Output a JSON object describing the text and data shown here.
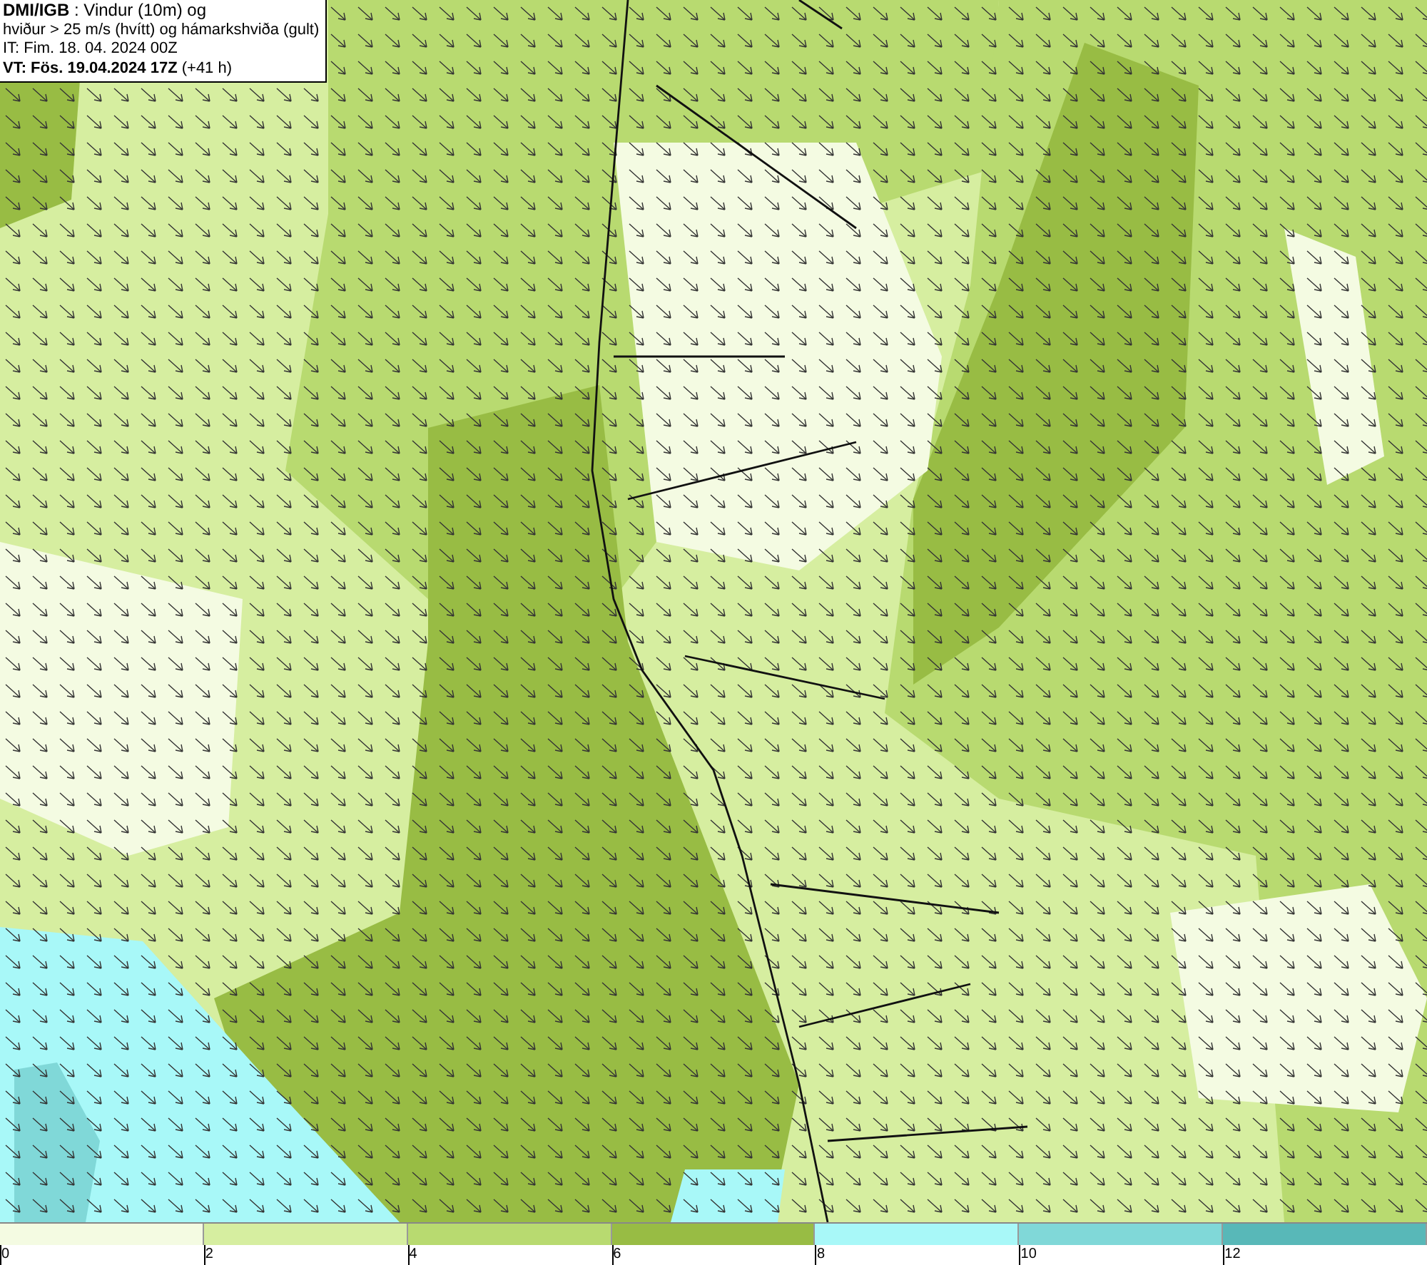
{
  "header": {
    "lines": [
      "**DMI/IGB** : Vindur (10m) og",
      "hviður > 25 m/s (hvítt) og hámarkshviða (gult)",
      "IT: Fim. 18. 04. 2024 00Z",
      "**VT: Fös. 19.04.2024 17Z** (+41 h)"
    ]
  },
  "legend": {
    "segments": [
      {
        "color": "#f4fbe2"
      },
      {
        "color": "#d6eea0"
      },
      {
        "color": "#b8da70"
      },
      {
        "color": "#98bc44"
      },
      {
        "color": "#a8f8f8"
      },
      {
        "color": "#80d8d8"
      },
      {
        "color": "#58b8b8"
      }
    ],
    "ticks": [
      "0",
      "2",
      "4",
      "6",
      "8",
      "10",
      "12"
    ]
  }
}
